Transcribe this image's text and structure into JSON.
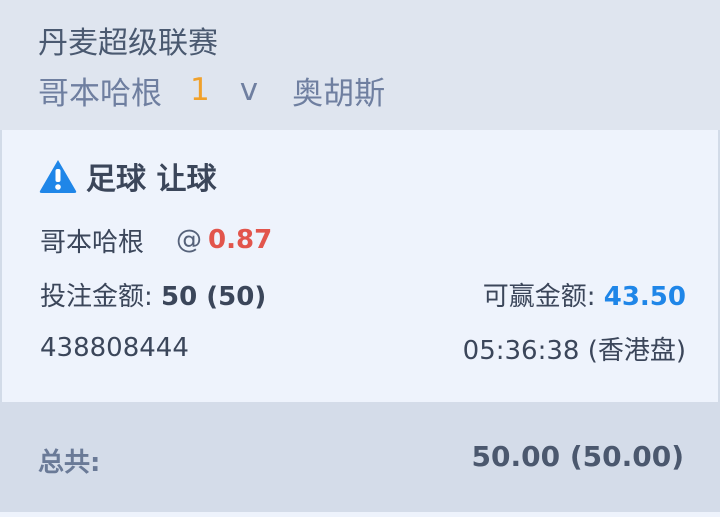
{
  "header": {
    "league": "丹麦超级联赛",
    "home_team": "哥本哈根",
    "score": "1",
    "vs": "v",
    "away_team": "奥胡斯"
  },
  "bet": {
    "icon": "warning-icon",
    "type_label": "足球 让球",
    "selection": "哥本哈根",
    "at": "@",
    "odds": "0.87",
    "stake_label": "投注金额: ",
    "stake_value": "50 (50)",
    "win_label": "可赢金额: ",
    "win_value": "43.50",
    "ticket_id": "438808444",
    "time": "05:36:38 (香港盘)"
  },
  "footer": {
    "total_label": "总共:",
    "total_value": "50.00 (50.00)"
  },
  "colors": {
    "odds": "#e2554c",
    "win_amount": "#1f86e8",
    "score": "#f0a12c",
    "warning_icon": "#1f86e8"
  }
}
